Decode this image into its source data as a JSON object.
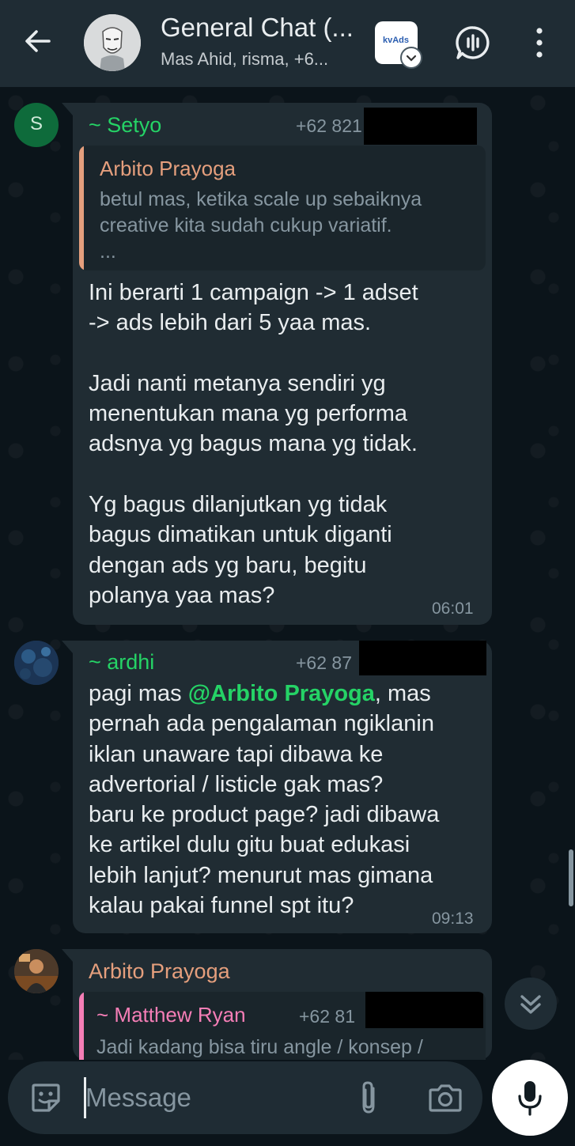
{
  "header": {
    "title": "General Chat (...",
    "subtitle": "Mas Ahid, risma, +6...",
    "app_badge_text": "kvAds"
  },
  "messages": [
    {
      "sender": "~ Setyo",
      "avatar_letter": "S",
      "phone": "+62 821",
      "quote": {
        "author": "Arbito Prayoga",
        "text": "betul mas, ketika scale up sebaiknya\ncreative kita sudah cukup variatif.\n..."
      },
      "text": "Ini berarti 1 campaign -> 1 adset\n-> ads lebih dari 5 yaa mas.\n\nJadi nanti metanya sendiri yg\nmenentukan mana yg performa\nadsnya yg bagus mana yg tidak.\n\nYg bagus dilanjutkan yg tidak\nbagus dimatikan untuk diganti\ndengan ads yg baru, begitu\npolanya yaa mas?",
      "time": "06:01"
    },
    {
      "sender": "~ ardhi",
      "phone": "+62 87",
      "text_before": "pagi mas ",
      "mention": "@Arbito Prayoga",
      "text_after": ", mas\npernah ada pengalaman ngiklanin\niklan unaware tapi dibawa ke\nadvertorial / listicle gak mas?\nbaru ke product page? jadi dibawa\nke artikel dulu gitu buat edukasi\nlebih lanjut? menurut mas gimana\nkalau pakai funnel spt itu?",
      "time": "09:13"
    },
    {
      "sender": "Arbito Prayoga",
      "quote": {
        "author": "~ Matthew Ryan",
        "phone": "+62 81",
        "text": "Jadi kadang bisa tiru angle / konsep /"
      }
    }
  ],
  "composer": {
    "placeholder": "Message"
  },
  "colors": {
    "setyo": "#25d366",
    "ardhi": "#25d366",
    "arbito": "#e59f7d",
    "matthew": "#f57eb6",
    "quote_bar_arbito": "#e59f7d"
  }
}
